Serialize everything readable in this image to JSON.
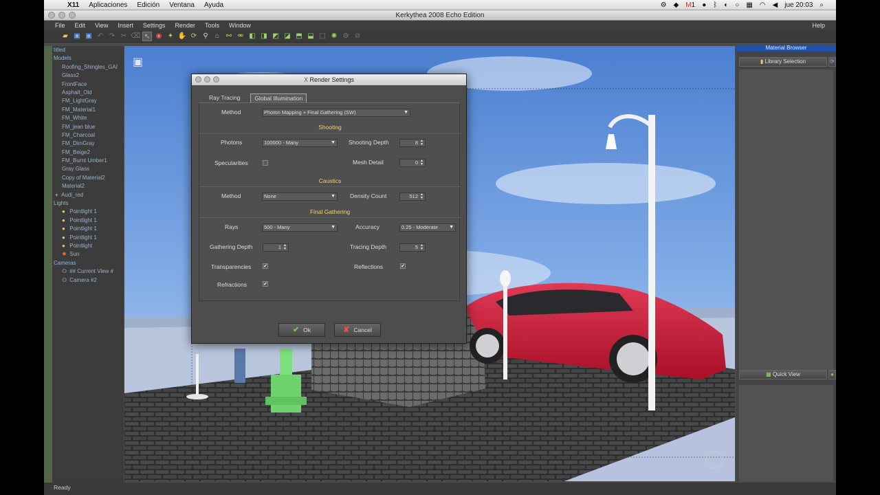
{
  "menubar": {
    "app": "X11",
    "items": [
      "Aplicaciones",
      "Edición",
      "Ventana",
      "Ayuda"
    ],
    "clock": "jue 20:03",
    "mail_count": "1"
  },
  "window": {
    "title": "Kerkythea 2008 Echo Edition",
    "menu": [
      "File",
      "Edit",
      "View",
      "Insert",
      "Settings",
      "Render",
      "Tools",
      "Window"
    ],
    "help": "Help"
  },
  "tree": {
    "root": "titled",
    "models_header": "Models",
    "models": [
      "Roofing_Shingles_GAI",
      "Glass2",
      "FrontFace",
      "Asphalt_Old",
      "FM_LightGray",
      "FM_Material1",
      "FM_White",
      "FM_jean blue",
      "FM_Charcoal",
      "FM_DimGray",
      "FM_Beige2",
      "FM_Burnt Umber1",
      "Gray Glass",
      "Copy of Material2",
      "Material2",
      "Audi_red"
    ],
    "lights_header": "Lights",
    "lights": [
      "Pointlight 1",
      "Pointlight 1",
      "Pointlight 1",
      "Pointlight 1",
      "Pointlight",
      "Sun"
    ],
    "cameras_header": "Cameras",
    "cameras": [
      "## Current View #",
      "Camera #2"
    ]
  },
  "right_panel": {
    "header": "Material Browser",
    "library_button": "Library Selection",
    "quick_view_button": "Quick View"
  },
  "status": "Ready",
  "dialog": {
    "title": "Render Settings",
    "tabs": [
      "Ray Tracing",
      "Global Illumination"
    ],
    "method_label": "Method",
    "method_value": "Photon Mapping + Final Gathering (SW)",
    "shooting_header": "Shooting",
    "photons_label": "Photons",
    "photons_value": "100000 - Many",
    "shooting_depth_label": "Shooting Depth",
    "shooting_depth_value": "8",
    "specularities_label": "Specularities",
    "specularities_checked": "",
    "mesh_detail_label": "Mesh Detail",
    "mesh_detail_value": "0",
    "caustics_header": "Caustics",
    "caustics_method_label": "Method",
    "caustics_method_value": "None",
    "density_count_label": "Density Count",
    "density_count_value": "512",
    "final_gathering_header": "Final Gathering",
    "rays_label": "Rays",
    "rays_value": "500 - Many",
    "accuracy_label": "Accuracy",
    "accuracy_value": "0.25 - Moderate",
    "gathering_depth_label": "Gathering Depth",
    "gathering_depth_value": "1",
    "tracing_depth_label": "Tracing Depth",
    "tracing_depth_value": "5",
    "transparencies_label": "Transparencies",
    "transparencies_checked": "✔",
    "reflections_label": "Reflections",
    "reflections_checked": "✔",
    "refractions_label": "Refractions",
    "refractions_checked": "✔",
    "ok_label": "Ok",
    "cancel_label": "Cancel"
  }
}
